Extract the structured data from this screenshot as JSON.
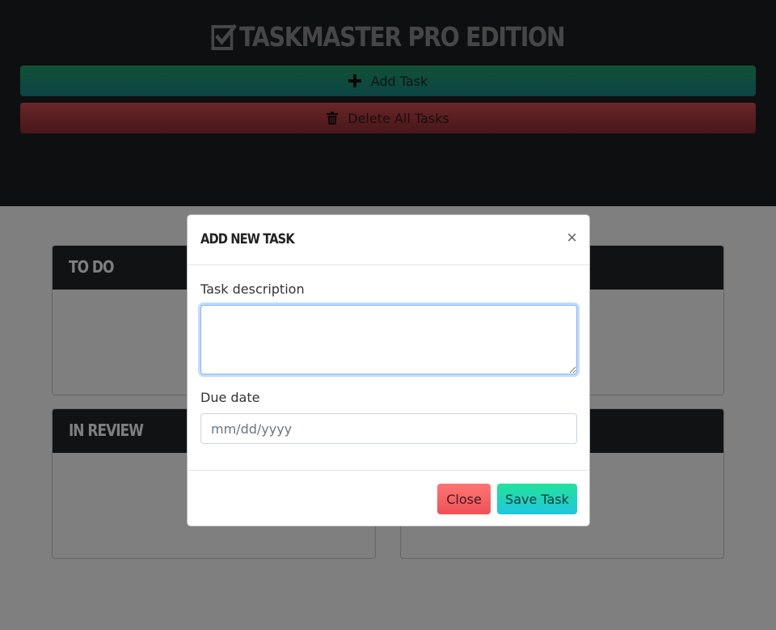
{
  "header": {
    "title": "TASKMASTER PRO EDITION",
    "add_label": "Add Task",
    "delete_label": "Delete All Tasks"
  },
  "board": {
    "columns": [
      {
        "title": "TO DO"
      },
      {
        "title": ""
      },
      {
        "title": "IN REVIEW"
      },
      {
        "title": ""
      }
    ]
  },
  "modal": {
    "title": "ADD NEW TASK",
    "close_glyph": "×",
    "description_label": "Task description",
    "description_value": "",
    "due_label": "Due date",
    "due_placeholder": "mm/dd/yyyy",
    "close_button": "Close",
    "save_button": "Save Task"
  },
  "icons": {
    "logo": "checkbox-check-icon",
    "add": "plus-icon",
    "delete": "trash-icon"
  },
  "colors": {
    "header_bg": "#1c1f23",
    "add_gradient": [
      "#24a36a",
      "#19898a"
    ],
    "delete_gradient": [
      "#d54c52",
      "#8d2f33"
    ],
    "close_button": "#f45d62",
    "save_button": "#20d5be"
  }
}
